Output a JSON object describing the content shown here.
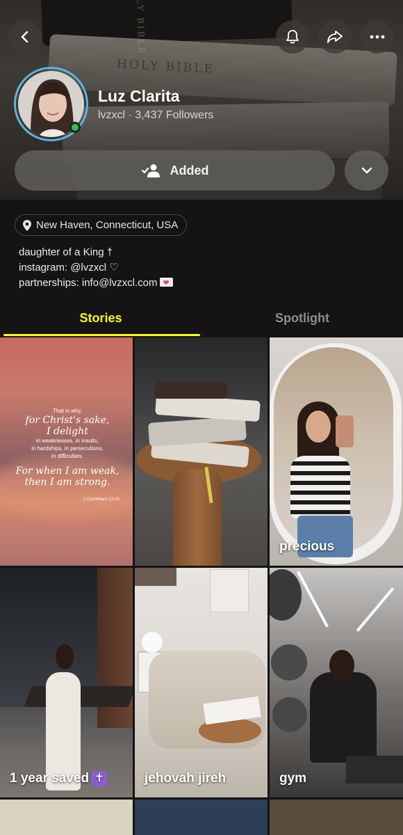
{
  "profile": {
    "name": "Luz Clarita",
    "username_followers": "lvzxcl · 3,437 Followers",
    "added_label": "Added",
    "location": "New Haven, Connecticut, USA",
    "bio": {
      "line1": "daughter of a King †",
      "line2": "instagram: @lvzxcl ♡",
      "line3": "partnerships: info@lvzxcl.com"
    }
  },
  "header": {
    "book_titles": [
      "HOLY BIBLE",
      "HOLY BIBLE"
    ]
  },
  "tabs": [
    {
      "label": "Stories",
      "active": true
    },
    {
      "label": "Spotlight",
      "active": false
    }
  ],
  "stories": [
    {
      "label": "",
      "quote": {
        "line1": "That is why,",
        "line2": "for Christ's sake,",
        "line3": "I delight",
        "line4": "in weaknesses, in insults,",
        "line5": "in hardships, in persecutions,",
        "line6": "in difficulties.",
        "line7": "For when I am weak,",
        "line8": "then I am strong.",
        "ref": "2 Corinthians 12:10"
      }
    },
    {
      "label": ""
    },
    {
      "label": "precious"
    },
    {
      "label": "1 year saved",
      "badge": "✝"
    },
    {
      "label": "jehovah jireh"
    },
    {
      "label": "gym"
    }
  ],
  "colors": {
    "accent_yellow": "#fffc00",
    "online_green": "#35c04c",
    "avatar_ring": "#57b7e6",
    "background": "#141414"
  },
  "icons": [
    "back-arrow-icon",
    "bell-icon",
    "share-icon",
    "more-icon",
    "added-person-icon",
    "chevron-down-icon",
    "location-pin-icon",
    "envelope-heart-icon"
  ]
}
